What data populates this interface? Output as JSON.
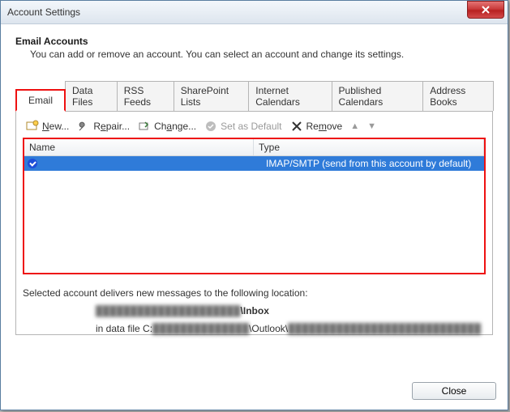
{
  "window": {
    "title": "Account Settings"
  },
  "header": {
    "title": "Email Accounts",
    "desc": "You can add or remove an account. You can select an account and change its settings."
  },
  "tabs": [
    {
      "label": "Email",
      "active": true
    },
    {
      "label": "Data Files"
    },
    {
      "label": "RSS Feeds"
    },
    {
      "label": "SharePoint Lists"
    },
    {
      "label": "Internet Calendars"
    },
    {
      "label": "Published Calendars"
    },
    {
      "label": "Address Books"
    }
  ],
  "toolbar": {
    "new": "New...",
    "repair": "Repair...",
    "change": "Change...",
    "set_default": "Set as Default",
    "remove": "Remove"
  },
  "columns": {
    "name": "Name",
    "type": "Type"
  },
  "accounts": [
    {
      "name": "",
      "type": "IMAP/SMTP (send from this account by default)",
      "selected": true,
      "default": true
    }
  ],
  "info": {
    "intro": "Selected account delivers new messages to the following location:",
    "line1_suffix": "\\Inbox",
    "line2_prefix": "in data file C:",
    "line2_mid": "\\Outlook\\"
  },
  "footer": {
    "close": "Close"
  }
}
